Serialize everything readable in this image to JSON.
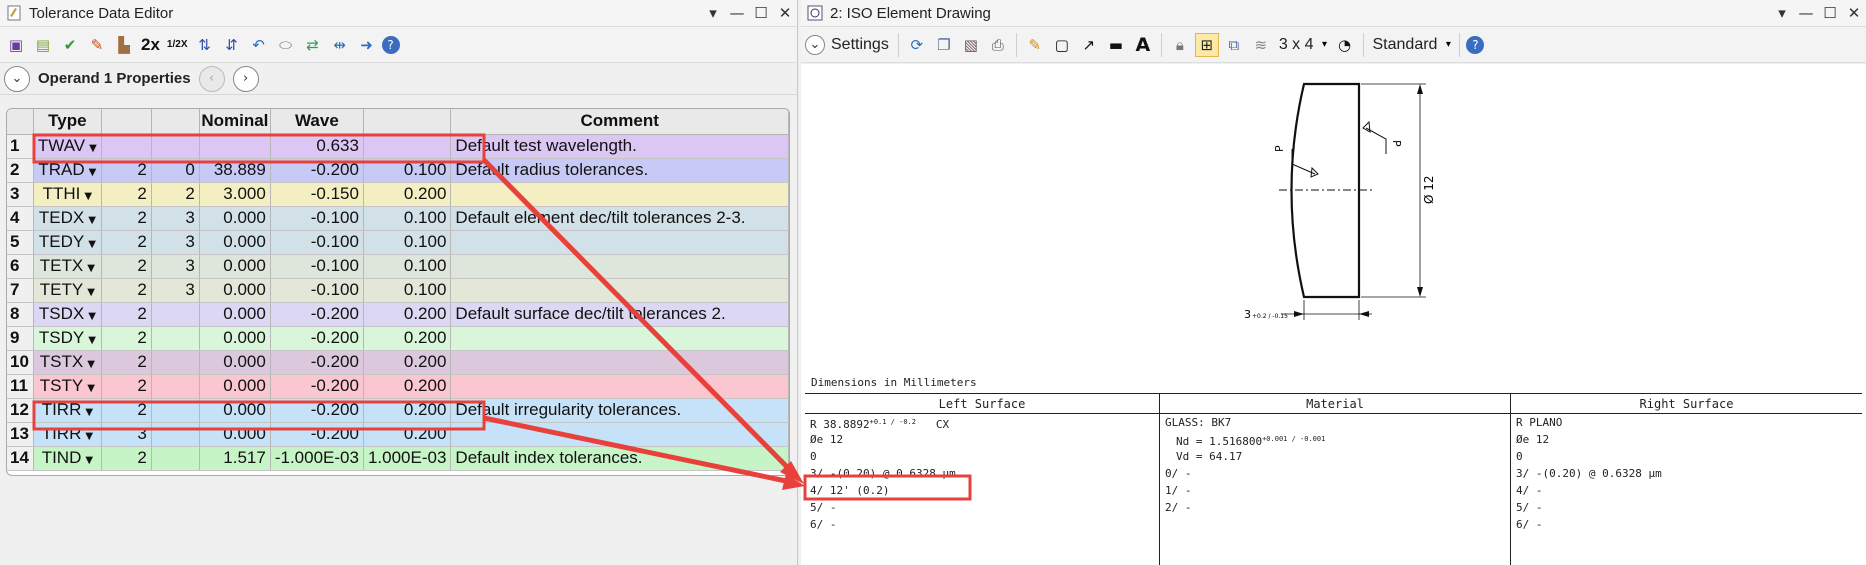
{
  "left_window": {
    "title": "Tolerance Data Editor",
    "toolbar_zoom_2x": "2x",
    "toolbar_zoom_half": "1/2X",
    "operand_label": "Operand  1 Properties",
    "columns": [
      "Type",
      "",
      "",
      "Nominal",
      "Wave",
      "",
      "Comment"
    ],
    "rows": [
      {
        "n": "1",
        "type": "TWAV",
        "c1": "",
        "c2": "",
        "nominal": "",
        "wave": "0.633",
        "c5": "",
        "comment": "Default test wavelength.",
        "bg": "#dcc6f4"
      },
      {
        "n": "2",
        "type": "TRAD",
        "c1": "2",
        "c2": "0",
        "nominal": "38.889",
        "wave": "-0.200",
        "c5": "0.100",
        "comment": "Default radius tolerances.",
        "bg": "#c8caf6"
      },
      {
        "n": "3",
        "type": "TTHI",
        "c1": "2",
        "c2": "2",
        "nominal": "3.000",
        "wave": "-0.150",
        "c5": "0.200",
        "comment": "",
        "bg": "#f4efc2"
      },
      {
        "n": "4",
        "type": "TEDX",
        "c1": "2",
        "c2": "3",
        "nominal": "0.000",
        "wave": "-0.100",
        "c5": "0.100",
        "comment": "Default element dec/tilt tolerances 2-3.",
        "bg": "#d2e0e8"
      },
      {
        "n": "5",
        "type": "TEDY",
        "c1": "2",
        "c2": "3",
        "nominal": "0.000",
        "wave": "-0.100",
        "c5": "0.100",
        "comment": "",
        "bg": "#d2e0e8"
      },
      {
        "n": "6",
        "type": "TETX",
        "c1": "2",
        "c2": "3",
        "nominal": "0.000",
        "wave": "-0.100",
        "c5": "0.100",
        "comment": "",
        "bg": "#dee6dc"
      },
      {
        "n": "7",
        "type": "TETY",
        "c1": "2",
        "c2": "3",
        "nominal": "0.000",
        "wave": "-0.100",
        "c5": "0.100",
        "comment": "",
        "bg": "#e2e7d8"
      },
      {
        "n": "8",
        "type": "TSDX",
        "c1": "2",
        "c2": "",
        "nominal": "0.000",
        "wave": "-0.200",
        "c5": "0.200",
        "comment": "Default surface dec/tilt tolerances 2.",
        "bg": "#dcd8f4"
      },
      {
        "n": "9",
        "type": "TSDY",
        "c1": "2",
        "c2": "",
        "nominal": "0.000",
        "wave": "-0.200",
        "c5": "0.200",
        "comment": "",
        "bg": "#daf6da"
      },
      {
        "n": "10",
        "type": "TSTX",
        "c1": "2",
        "c2": "",
        "nominal": "0.000",
        "wave": "-0.200",
        "c5": "0.200",
        "comment": "",
        "bg": "#dcc8dc"
      },
      {
        "n": "11",
        "type": "TSTY",
        "c1": "2",
        "c2": "",
        "nominal": "0.000",
        "wave": "-0.200",
        "c5": "0.200",
        "comment": "",
        "bg": "#fac6d0"
      },
      {
        "n": "12",
        "type": "TIRR",
        "c1": "2",
        "c2": "",
        "nominal": "0.000",
        "wave": "-0.200",
        "c5": "0.200",
        "comment": "Default irregularity tolerances.",
        "bg": "#c6e2f8"
      },
      {
        "n": "13",
        "type": "TIRR",
        "c1": "3",
        "c2": "",
        "nominal": "0.000",
        "wave": "-0.200",
        "c5": "0.200",
        "comment": "",
        "bg": "#c6e2f8"
      },
      {
        "n": "14",
        "type": "TIND",
        "c1": "2",
        "c2": "",
        "nominal": "1.517",
        "wave": "-1.000E-03",
        "c5": "1.000E-03",
        "comment": "Default index tolerances.",
        "bg": "#c6f4c6"
      }
    ]
  },
  "right_window": {
    "title": "2: ISO Element Drawing",
    "settings_label": "Settings",
    "layout_label": "3 x 4",
    "style_label": "Standard",
    "drawing": {
      "label_p_left": "P",
      "label_p_right": "P",
      "diameter_label": "Ø 12",
      "thickness_label": "3",
      "thickness_tol": "+0.2 / -0.15",
      "dims_note": "Dimensions in Millimeters"
    },
    "iso": {
      "left_head": "Left Surface",
      "mat_head": "Material",
      "right_head": "Right Surface",
      "left_lines": [
        "R 38.8892",
        "Øe 12",
        "0",
        "3/ -(0.20) @ 0.6328 µm",
        "4/ 12' (0.2)",
        "5/ -",
        "6/ -"
      ],
      "left_r_tol": "+0.1 / -0.2",
      "left_r_suffix": "CX",
      "mat_lines": [
        "GLASS: BK7",
        "Nd = 1.516800",
        "Vd = 64.17",
        "0/ -",
        "1/ -",
        "2/ -"
      ],
      "mat_nd_tol": "+0.001 / -0.001",
      "right_lines": [
        "R PLANO",
        "Øe 12",
        "0",
        "3/ -(0.20) @ 0.6328 µm",
        "4/ -",
        "5/ -",
        "6/ -"
      ]
    }
  },
  "colors": {
    "annotation": "#e8413c"
  }
}
